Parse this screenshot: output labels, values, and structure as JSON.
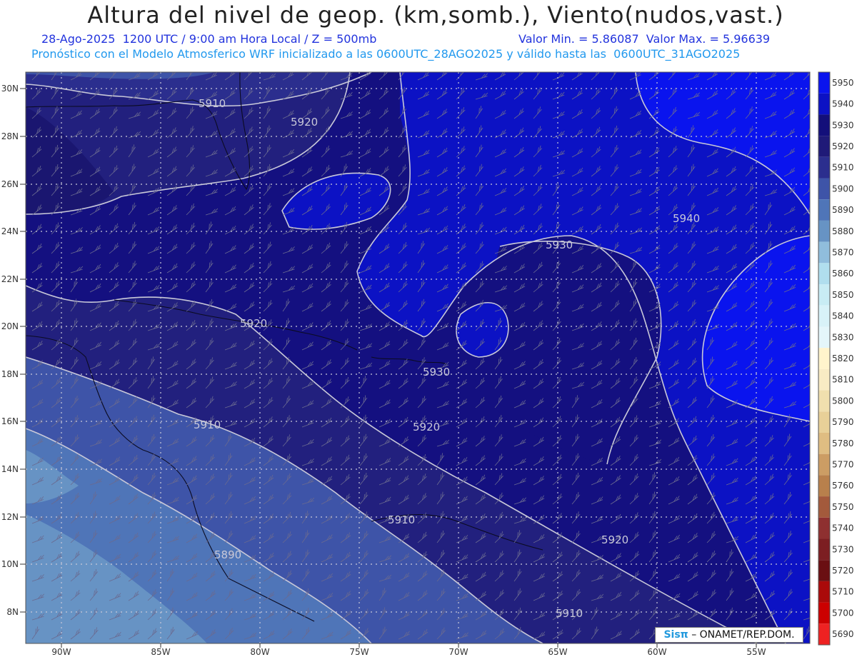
{
  "header": {
    "title": "Altura del nivel de geop. (km,somb.), Viento(nudos,vast.)",
    "subtitle_left": "28-Ago-2025  1200 UTC / 9:00 am Hora Local / Z = 500mb",
    "subtitle_right": "Valor Min. = 5.86087  Valor Max. = 5.96639",
    "subtitle_model": "Pronóstico con el Modelo Atmosferico WRF inicializado a las 0600UTC_28AGO2025 y válido hasta las  0600UTC_31AGO2025"
  },
  "map": {
    "lat_labels": [
      "30N",
      "28N",
      "26N",
      "24N",
      "22N",
      "20N",
      "18N",
      "16N",
      "14N",
      "12N",
      "10N",
      "8N"
    ],
    "lon_labels": [
      "90W",
      "85W",
      "80W",
      "75W",
      "70W",
      "65W",
      "60W",
      "55W"
    ],
    "contour_labels": [
      "5910",
      "5920",
      "5940",
      "5930",
      "5920",
      "5930",
      "5910",
      "5920",
      "5910",
      "5920",
      "5890",
      "5910"
    ]
  },
  "colorbar": {
    "levels": [
      "5950",
      "5940",
      "5930",
      "5920",
      "5910",
      "5900",
      "5890",
      "5880",
      "5870",
      "5860",
      "5850",
      "5840",
      "5830",
      "5820",
      "5810",
      "5800",
      "5790",
      "5780",
      "5770",
      "5760",
      "5750",
      "5740",
      "5730",
      "5720",
      "5710",
      "5700",
      "5690"
    ],
    "colors": [
      "#0a14ee",
      "#0c12c4",
      "#130f7a",
      "#1f1a78",
      "#2b2e8e",
      "#3e54a8",
      "#4f75b8",
      "#6793c4",
      "#90bddc",
      "#b0deee",
      "#c8ecf4",
      "#d8f2f8",
      "#e4f6fa",
      "#fff4cc",
      "#f8ebc4",
      "#f0dfae",
      "#e8d098",
      "#dfbd82",
      "#cc9d64",
      "#b8804c",
      "#a35a3c",
      "#8e3030",
      "#7c1e22",
      "#6a0f12",
      "#aa0a0a",
      "#cc0000",
      "#ee2222"
    ]
  },
  "credit": {
    "logo": "Sisπ",
    "text": "– ONAMET/REP.DOM."
  },
  "colors": {
    "title": "#222222",
    "subtitle_blue": "#2233dd",
    "subtitle_cyan": "#2299ee"
  }
}
